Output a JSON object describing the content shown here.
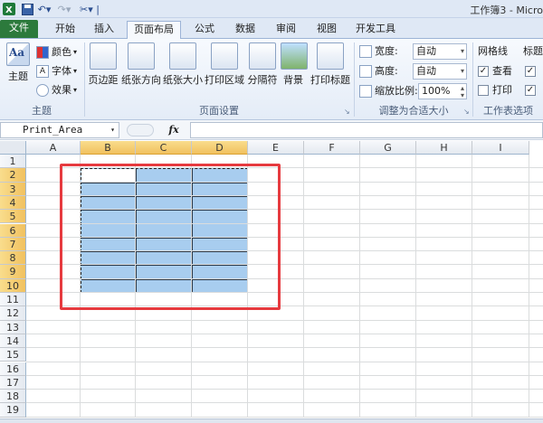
{
  "window": {
    "title": "工作簿3 - Micro"
  },
  "ribbon_tabs": [
    "文件",
    "开始",
    "插入",
    "页面布局",
    "公式",
    "数据",
    "审阅",
    "视图",
    "开发工具"
  ],
  "themes_group": {
    "label": "主题",
    "theme_button": "主题",
    "colors": "颜色",
    "fonts": "字体",
    "effects": "效果"
  },
  "page_setup_group": {
    "label": "页面设置",
    "margins": "页边距",
    "orientation": "纸张方向",
    "size": "纸张大小",
    "print_area": "打印区域",
    "breaks": "分隔符",
    "background": "背景",
    "print_titles": "打印标题"
  },
  "scale_group": {
    "label": "调整为合适大小",
    "width_label": "宽度:",
    "width_value": "自动",
    "height_label": "高度:",
    "height_value": "自动",
    "scale_label": "缩放比例:",
    "scale_value": "100%"
  },
  "sheet_options_group": {
    "label": "工作表选项",
    "gridlines": "网格线",
    "gridlines_view": "查看",
    "gridlines_print": "打印",
    "headings": "标题"
  },
  "formula_bar": {
    "name_box": "Print_Area",
    "fx": "fx",
    "formula": ""
  },
  "columns": [
    "A",
    "B",
    "C",
    "D",
    "E",
    "F",
    "G",
    "H",
    "I"
  ],
  "rows": [
    "1",
    "2",
    "3",
    "4",
    "5",
    "6",
    "7",
    "8",
    "9",
    "10",
    "11",
    "12",
    "13",
    "14",
    "15",
    "16",
    "17",
    "18",
    "19"
  ],
  "selected_columns": [
    "B",
    "C",
    "D"
  ],
  "selected_rows": [
    "2",
    "3",
    "4",
    "5",
    "6",
    "7",
    "8",
    "9",
    "10"
  ],
  "colors": {
    "selection": "#a8cdef",
    "highlight_box": "#e63a3f",
    "file_tab": "#2c7a3c"
  }
}
